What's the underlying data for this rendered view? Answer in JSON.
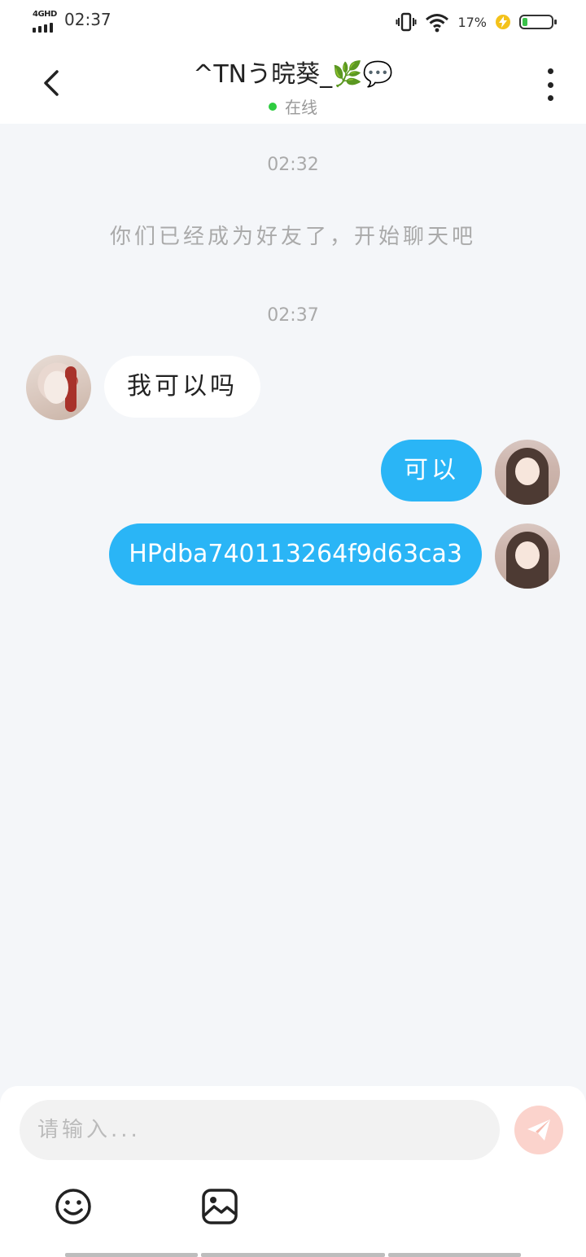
{
  "status_bar": {
    "network": "4GHD",
    "time": "02:37",
    "battery_percent": "17%",
    "battery_level": 0.17,
    "icons": [
      "vibrate-icon",
      "wifi-icon",
      "charging-icon",
      "battery-icon"
    ]
  },
  "header": {
    "back_icon": "chevron-left-icon",
    "title": "^TNう晥葵_🌿💬",
    "status": "在线",
    "status_color": "#2ecc40",
    "more_icon": "more-vertical-icon"
  },
  "chat": {
    "timestamp_1": "02:32",
    "system_message": "你们已经成为好友了，开始聊天吧",
    "timestamp_2": "02:37",
    "messages": [
      {
        "side": "left",
        "text": "我可以吗"
      },
      {
        "side": "right",
        "text": "可以"
      },
      {
        "side": "right",
        "text": "HPdba740113264f9d63ca3"
      }
    ]
  },
  "composer": {
    "placeholder": "请输入...",
    "send_icon": "send-icon",
    "emoji_icon": "emoji-icon",
    "image_icon": "image-icon"
  },
  "colors": {
    "accent": "#2ab5f6",
    "send_button": "#fbd3cc",
    "background": "#f4f6f9"
  }
}
